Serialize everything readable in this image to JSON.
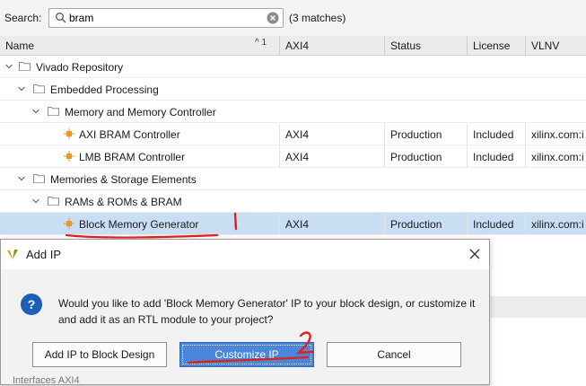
{
  "search": {
    "label": "Search:",
    "value": "bram",
    "match_count": "(3 matches)"
  },
  "columns": {
    "name": "Name",
    "sort_indicator": "^ 1",
    "axi4": "AXI4",
    "status": "Status",
    "license": "License",
    "vlnv": "VLNV"
  },
  "tree": [
    {
      "label": "Vivado Repository",
      "axi4": "",
      "status": "",
      "license": "",
      "vlnv": ""
    },
    {
      "label": "Embedded Processing",
      "axi4": "",
      "status": "",
      "license": "",
      "vlnv": ""
    },
    {
      "label": "Memory and Memory Controller",
      "axi4": "",
      "status": "",
      "license": "",
      "vlnv": ""
    },
    {
      "label": "AXI BRAM Controller",
      "axi4": "AXI4",
      "status": "Production",
      "license": "Included",
      "vlnv": "xilinx.com:i"
    },
    {
      "label": "LMB BRAM Controller",
      "axi4": "AXI4",
      "status": "Production",
      "license": "Included",
      "vlnv": "xilinx.com:i"
    },
    {
      "label": "Memories & Storage Elements",
      "axi4": "",
      "status": "",
      "license": "",
      "vlnv": ""
    },
    {
      "label": "RAMs & ROMs & BRAM",
      "axi4": "",
      "status": "",
      "license": "",
      "vlnv": ""
    },
    {
      "label": "Block Memory Generator",
      "axi4": "AXI4",
      "status": "Production",
      "license": "Included",
      "vlnv": "xilinx.com:i"
    }
  ],
  "annotations": {
    "mark_1": "1",
    "mark_2": "2"
  },
  "dialog": {
    "title": "Add IP",
    "message": "Would you like to add 'Block Memory Generator' IP to your block design, or customize it and add it as an RTL module to your project?",
    "buttons": {
      "add_to_block_design": "Add IP to Block Design",
      "customize": "Customize IP",
      "cancel": "Cancel"
    }
  },
  "bottom_peek": "Interfaces     AXI4",
  "colors": {
    "selected_row": "#c9ddf3",
    "primary_button": "#4a86d9",
    "annotation_red": "#e0201a",
    "question_icon": "#1c5fb6"
  }
}
